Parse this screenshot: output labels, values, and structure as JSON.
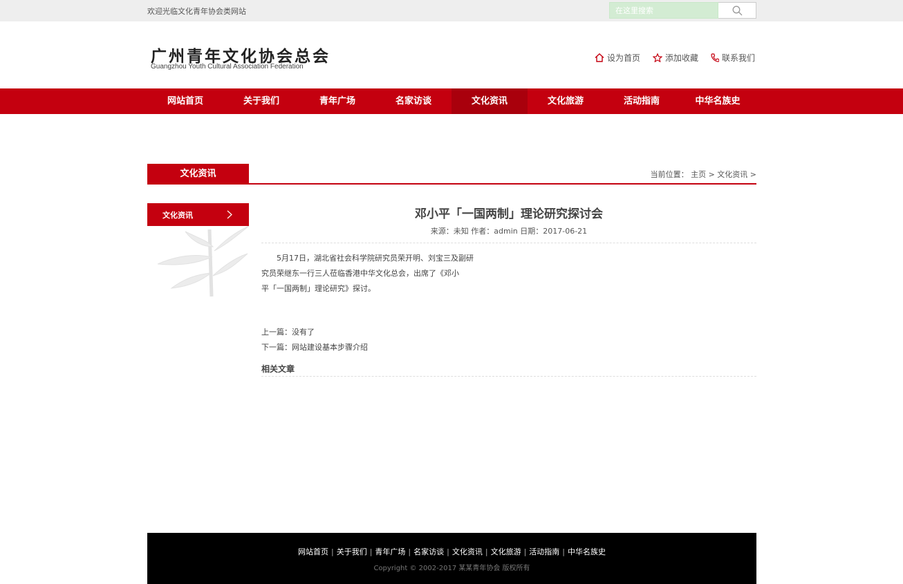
{
  "topbar": {
    "welcome": "欢迎光临文化青年协会类网站",
    "search_placeholder": "在这里搜索"
  },
  "header": {
    "logo_cn": "广州青年文化协会总会",
    "logo_en": "Guangzhou Youth Cultural Association Federation",
    "quicklinks": [
      "设为首页",
      "添加收藏",
      "联系我们"
    ]
  },
  "nav": {
    "items": [
      "网站首页",
      "关于我们",
      "青年广场",
      "名家访谈",
      "文化资讯",
      "文化旅游",
      "活动指南",
      "中华名族史"
    ],
    "active": "文化资讯"
  },
  "section": {
    "title": "文化资讯",
    "breadcrumb": "当前位置： 主页 > 文化资讯 >"
  },
  "sidebar": {
    "items": [
      "文化资讯"
    ]
  },
  "article": {
    "title": "邓小平「一国两制」理论研究探讨会",
    "meta": "来源：未知 作者：admin 日期：2017-06-21",
    "body": [
      "5月17日，湖北省社会科学院研究员荣开明、刘宝三及副研",
      "究员荣继东一行三人莅临香港中华文化总会，出席了《邓小",
      "平「一国两制」理论研究》探讨。"
    ],
    "prev": "上一篇：没有了",
    "next": "下一篇：网站建设基本步骤介绍",
    "related_heading": "相关文章"
  },
  "footer": {
    "links": [
      "网站首页",
      "关于我们",
      "青年广场",
      "名家访谈",
      "文化资讯",
      "文化旅游",
      "活动指南",
      "中华名族史"
    ],
    "copyright": "Copyright © 2002-2017 某某青年协会 版权所有"
  },
  "colors": {
    "brand_red": "#c4000f",
    "nav_active": "#a9000c",
    "footer_bg": "#000000",
    "search_bg": "#d3ecd3"
  },
  "icons": {
    "search": "search-icon",
    "home": "home-icon",
    "favorite": "star-icon",
    "contact": "phone-icon",
    "sidebar_arrow": "chevron-right-icon"
  }
}
